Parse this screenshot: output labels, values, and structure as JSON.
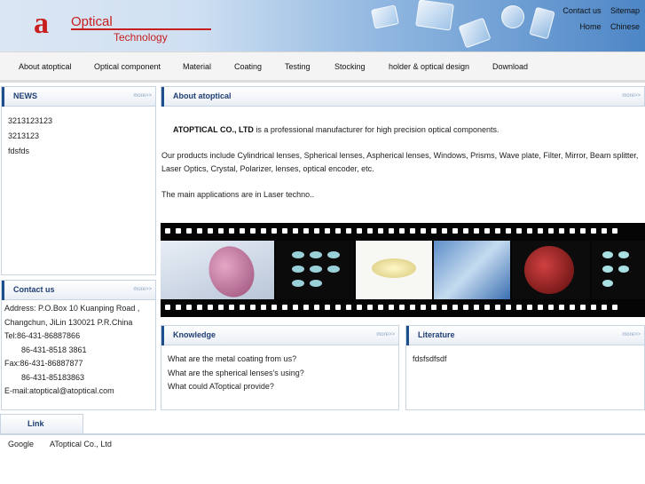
{
  "header": {
    "logo_mark": "a",
    "logo_line1": "Optical",
    "logo_line2": "Technology",
    "contact_us": "Contact us",
    "sitemap": "Sitemap",
    "home": "Home",
    "chinese": "Chinese"
  },
  "nav": {
    "items": [
      "About atoptical",
      "Optical component",
      "Material",
      "Coating",
      "Testing",
      "Stocking",
      "holder & optical design",
      "Download"
    ]
  },
  "news": {
    "title": "NEWS",
    "more": "more>>",
    "items": [
      "3213123123",
      "3213123",
      "fdsfds"
    ]
  },
  "about": {
    "title": "About atoptical",
    "more": "more>>",
    "company": "ATOPTICAL CO., LTD",
    "intro": " is a professional manufacturer for high precision optical components.",
    "products": "Our products include Cylindrical lenses, Spherical lenses, Aspherical lenses, Windows, Prisms, Wave plate, Filter, Mirror, Beam splitter, Laser Optics, Crystal, Polarizer, lenses, optical encoder, etc.",
    "applications": "The main applications are in Laser techno.."
  },
  "contact": {
    "title": "Contact us",
    "more": "more>>",
    "lines": [
      "Address: P.O.Box 10 Kuanping Road ,",
      "Changchun, JiLin 130021 P.R.China",
      "Tel:86-431-86887866",
      "86-431-8518 3861",
      "Fax:86-431-86887877",
      "86-431-85183863",
      "E-mail:atoptical@atoptical.com"
    ]
  },
  "knowledge": {
    "title": "Knowledge",
    "more": "more>>",
    "items": [
      "What are the metal coating from us?",
      "What are the spherical lenses's using?",
      "What could AToptical provide?"
    ]
  },
  "literature": {
    "title": "Literature",
    "more": "more>>",
    "items": [
      "fdsfsdfsdf"
    ]
  },
  "links": {
    "title": "Link",
    "items": [
      "Google",
      "AToptical Co., Ltd"
    ]
  },
  "colors": {
    "brand_red": "#c81e1e",
    "heading_blue": "#1f3f74"
  }
}
